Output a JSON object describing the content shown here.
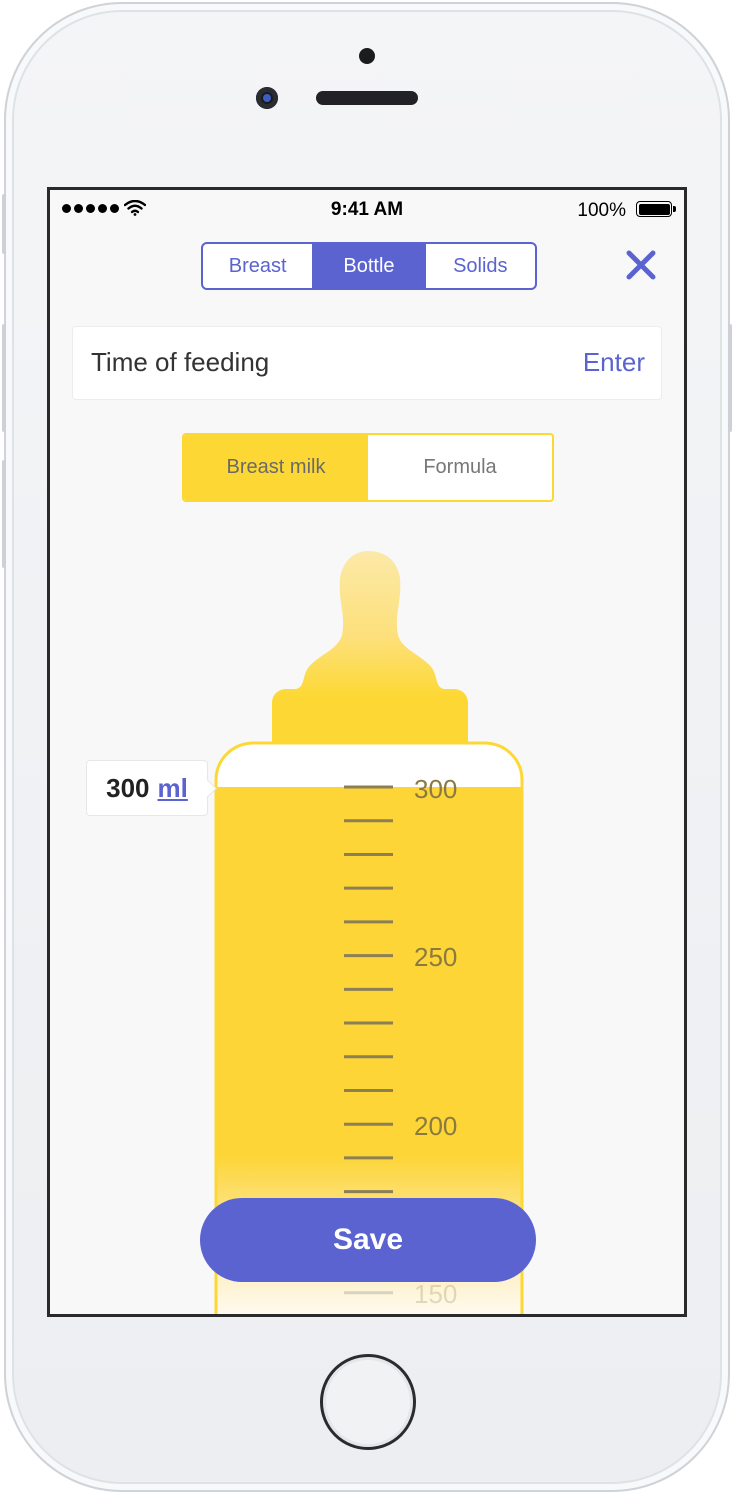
{
  "status_bar": {
    "time": "9:41 AM",
    "battery_percent": "100%",
    "signal_bars": 5
  },
  "feeding_type_tabs": {
    "items": [
      "Breast",
      "Bottle",
      "Solids"
    ],
    "selected": "Bottle"
  },
  "close_icon": "close-icon",
  "time_of_feeding": {
    "label": "Time of feeding",
    "action": "Enter"
  },
  "milk_type": {
    "items": [
      "Breast milk",
      "Formula"
    ],
    "selected": "Breast milk"
  },
  "volume": {
    "amount": "300",
    "unit": "ml",
    "max_scale": 300
  },
  "scale": {
    "labels": [
      "300",
      "250",
      "200",
      "150"
    ]
  },
  "save_button": {
    "label": "Save"
  },
  "colors": {
    "accent": "#5a63d0",
    "milk": "#fdd835"
  }
}
